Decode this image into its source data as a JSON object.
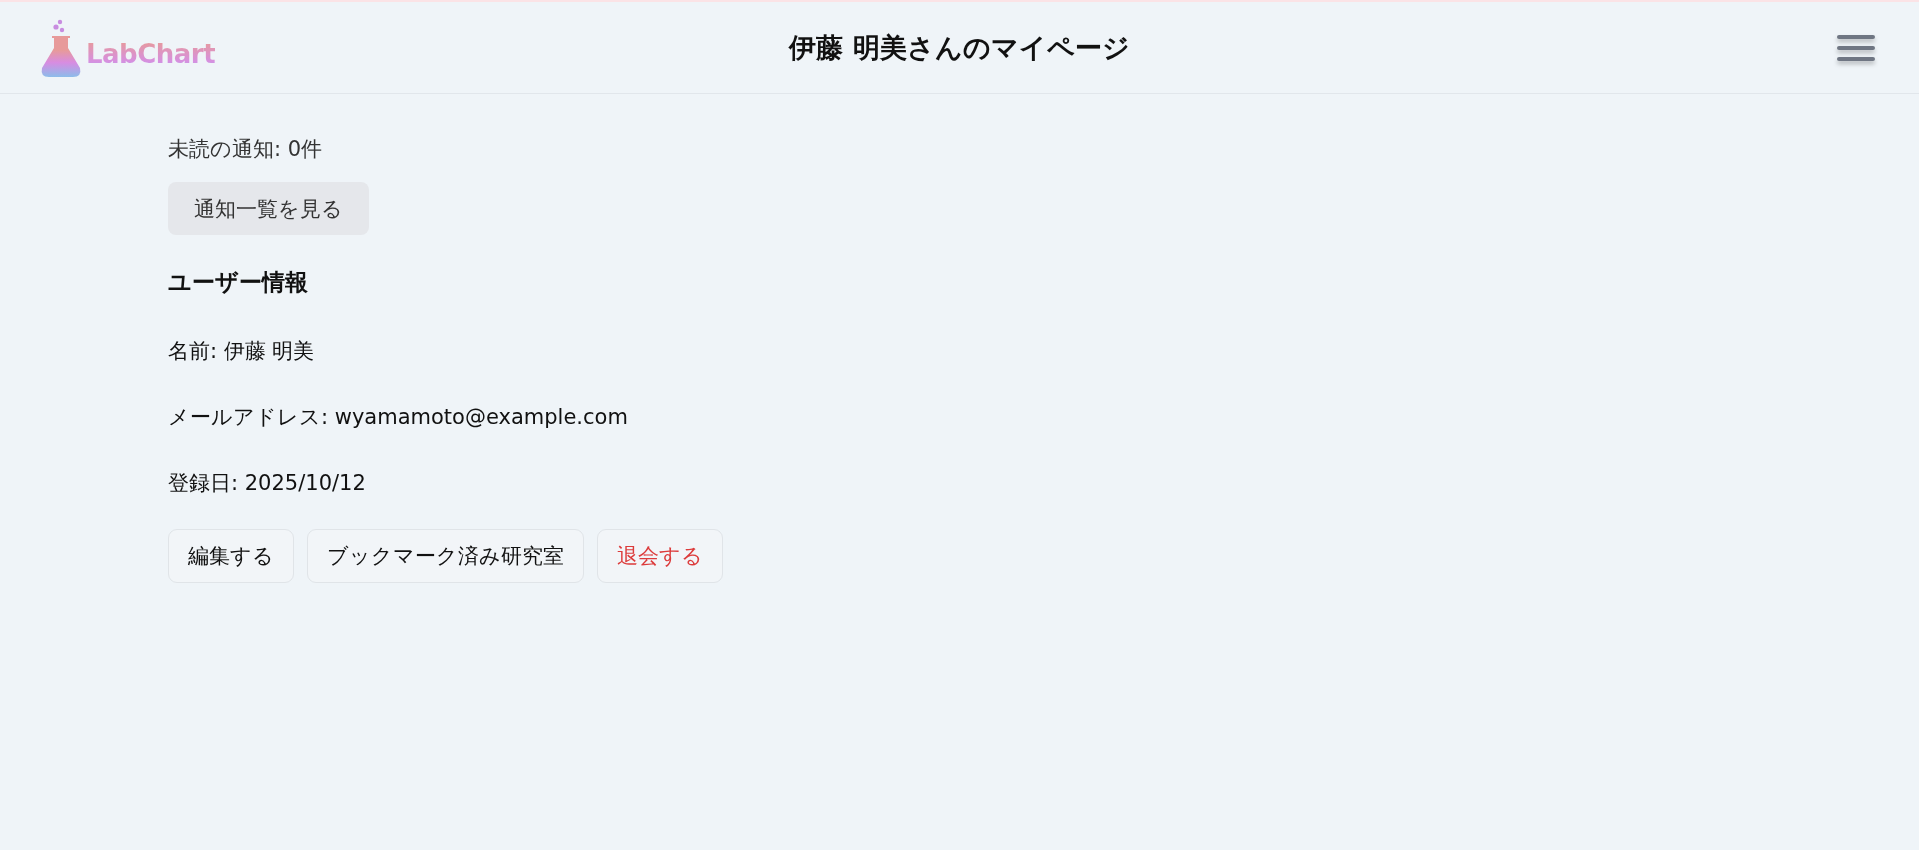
{
  "header": {
    "logo": {
      "text": "LabChart"
    },
    "title": "伊藤 明美さんのマイページ"
  },
  "notifications": {
    "unread": "未読の通知: 0件",
    "button": "通知一覧を見る"
  },
  "user_info": {
    "heading": "ユーザー情報",
    "fields": [
      "名前: 伊藤 明美",
      "メールアドレス: wyamamoto@example.com",
      "登録日: 2025/10/12"
    ]
  },
  "actions": [
    {
      "label": "編集する",
      "kind": "normal"
    },
    {
      "label": "ブックマーク済み研究室",
      "kind": "normal"
    },
    {
      "label": "退会する",
      "kind": "danger"
    }
  ]
}
